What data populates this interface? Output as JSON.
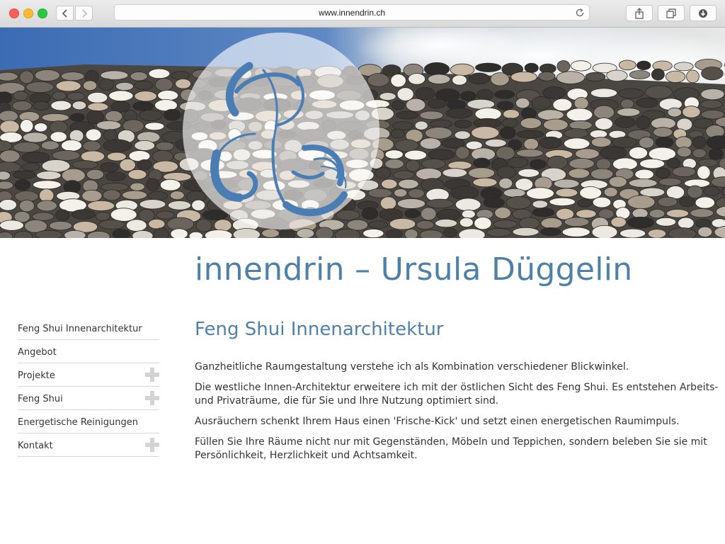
{
  "browser": {
    "url": "www.innendrin.ch"
  },
  "header": {
    "banner_image": "dry stone wall under blue sky",
    "logo": "blue brush stroke logo on translucent white circle"
  },
  "site": {
    "title": "innendrin – Ursula Düggelin"
  },
  "sidebar": {
    "items": [
      {
        "label": "Feng Shui Innenarchitektur",
        "has_submenu": false
      },
      {
        "label": "Angebot",
        "has_submenu": false
      },
      {
        "label": "Projekte",
        "has_submenu": true
      },
      {
        "label": "Feng Shui",
        "has_submenu": true
      },
      {
        "label": "Energetische Reinigungen",
        "has_submenu": false
      },
      {
        "label": "Kontakt",
        "has_submenu": true
      }
    ],
    "expand_icon": "plus-icon"
  },
  "main": {
    "heading": "Feng Shui Innenarchitektur",
    "paragraphs": [
      "Ganzheitliche Raumgestaltung verstehe ich als Kombination verschiedener Blickwinkel.",
      "Die westliche Innen-Architektur erweitere ich mit der östlichen Sicht des Feng Shui. Es entstehen Arbeits- und Privaträume, die für Sie und Ihre Nutzung optimiert sind.",
      "Ausräuchern schenkt Ihrem Haus einen 'Frische-Kick' und setzt einen energetischen Raumimpuls.",
      "Füllen Sie Ihre Räume nicht nur mit Gegenständen, Möbeln und Teppichen, sondern beleben Sie sie mit Persönlichkeit, Herzlichkeit und Achtsamkeit."
    ]
  },
  "colors": {
    "accent": "#4e80a9",
    "text": "#333333",
    "divider": "#d7d7d7",
    "plus": "#d3d3d3"
  }
}
